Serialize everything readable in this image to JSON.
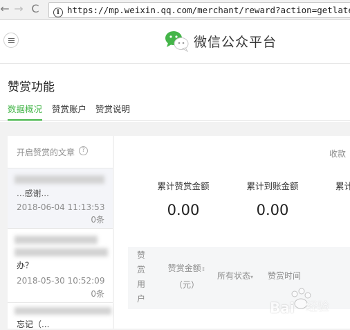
{
  "browser": {
    "url": "https://mp.weixin.qq.com/merchant/reward?action=getlatestre"
  },
  "header": {
    "brand": "微信公众平台"
  },
  "page": {
    "title": "赞赏功能",
    "tabs": [
      {
        "label": "数据概况",
        "active": true
      },
      {
        "label": "赞赏账户",
        "active": false
      },
      {
        "label": "赞赏说明",
        "active": false
      }
    ]
  },
  "left_panel": {
    "heading": "开启赞赏的文章",
    "articles": [
      {
        "title": "...感谢...",
        "date": "2018-06-04 11:13:53",
        "count": "0条"
      },
      {
        "title": "办？",
        "date": "2018-05-30 10:52:09",
        "count": "0条"
      },
      {
        "title": "忘记（...",
        "date": "",
        "count": ""
      }
    ]
  },
  "right_panel": {
    "income_label": "收款",
    "stats": [
      {
        "label": "累计赞赏金额",
        "value": "0.00"
      },
      {
        "label": "累计到账金额",
        "value": "0.00"
      },
      {
        "label": "累计",
        "value": ""
      }
    ],
    "table_headers": {
      "user": [
        "赞",
        "赏",
        "用",
        "户"
      ],
      "amount": [
        "赞赏金额",
        "（元）"
      ],
      "status": "所有状态",
      "time": "赞赏时间"
    }
  },
  "watermark": {
    "text": "Bai",
    "sub": "经验"
  },
  "colors": {
    "accent": "#44b549",
    "brand_green": "#44b549"
  }
}
